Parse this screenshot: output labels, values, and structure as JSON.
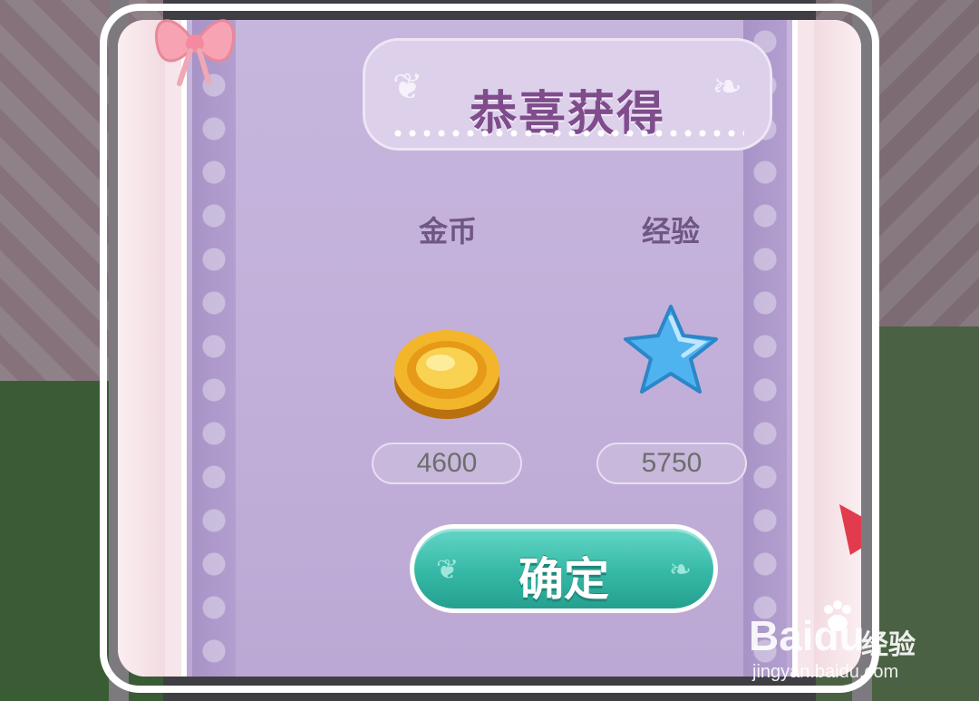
{
  "dialog": {
    "title": "恭喜获得",
    "rewards": [
      {
        "label": "金币",
        "icon": "gold-coin-icon",
        "value": "4600"
      },
      {
        "label": "经验",
        "icon": "blue-star-icon",
        "value": "5750"
      }
    ],
    "confirm_label": "确定"
  },
  "watermark": {
    "brand": "Baidu",
    "sub": "经验",
    "url": "jingyan.baidu.com"
  },
  "colors": {
    "panel": "#c2b0da",
    "title": "#7f4c8c",
    "button": "#36b8a6",
    "arrow": "#e23b4e"
  }
}
